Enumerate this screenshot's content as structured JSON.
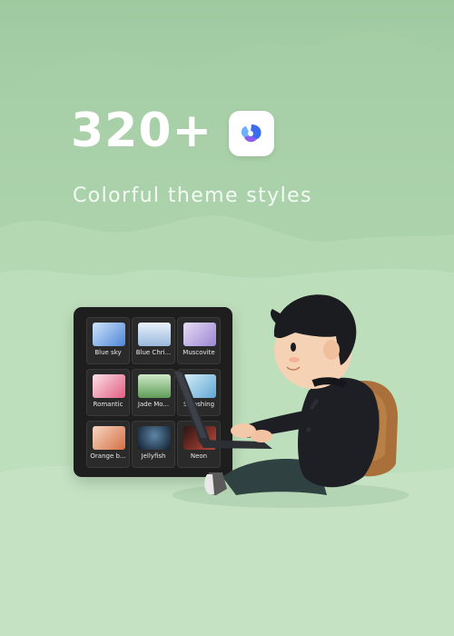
{
  "headline": {
    "count": "320+"
  },
  "subtitle": "Colorful theme styles",
  "app_icon": "flower-app-icon",
  "themes": [
    {
      "label": "Blue sky",
      "color": "#8fb8e8"
    },
    {
      "label": "Blue Chri...",
      "color": "#bcd3ea"
    },
    {
      "label": "Muscovite",
      "color": "#c3b3e0"
    },
    {
      "label": "Romantic",
      "color": "#e99ab0"
    },
    {
      "label": "Jade Mo...",
      "color": "#8fbf8a"
    },
    {
      "label": "Splashing",
      "color": "#8fc6e6"
    },
    {
      "label": "Orange b...",
      "color": "#e7a27d"
    },
    {
      "label": "Jellyfish",
      "color": "#1f3447"
    },
    {
      "label": "Neon",
      "color": "#b84a3f"
    }
  ],
  "illustration": "boy-with-laptop-illustration"
}
